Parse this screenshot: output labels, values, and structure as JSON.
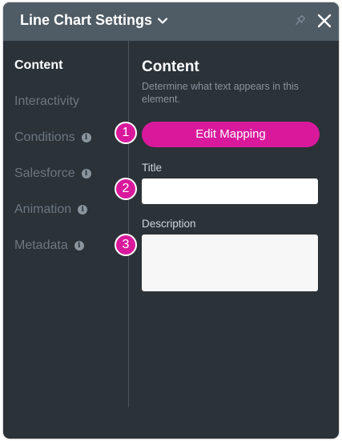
{
  "header": {
    "title": "Line Chart Settings"
  },
  "sidebar": {
    "items": [
      {
        "label": "Content",
        "active": true,
        "info": false
      },
      {
        "label": "Interactivity",
        "active": false,
        "info": false
      },
      {
        "label": "Conditions",
        "active": false,
        "info": true
      },
      {
        "label": "Salesforce",
        "active": false,
        "info": true
      },
      {
        "label": "Animation",
        "active": false,
        "info": true
      },
      {
        "label": "Metadata",
        "active": false,
        "info": true
      }
    ],
    "info_glyph": "i"
  },
  "content": {
    "title": "Content",
    "description": "Determine what text appears in this element.",
    "edit_mapping_label": "Edit Mapping",
    "title_field_label": "Title",
    "title_value": "",
    "description_field_label": "Description",
    "description_value": ""
  },
  "badges": [
    "1",
    "2",
    "3"
  ],
  "colors": {
    "accent": "#d9199c",
    "panel_bg": "#2b3238",
    "header_bg": "#4f5c66"
  }
}
